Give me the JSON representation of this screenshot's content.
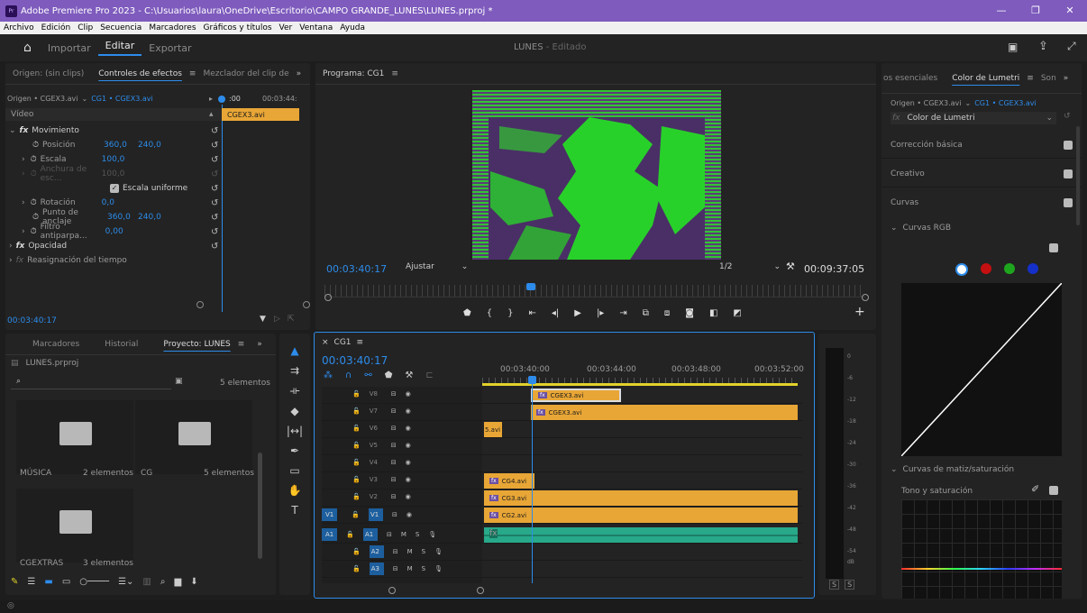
{
  "window": {
    "title": "Adobe Premiere Pro 2023 - C:\\Usuarios\\laura\\OneDrive\\Escritorio\\CAMPO GRANDE_LUNES\\LUNES.prproj *",
    "app_icon": "Pr"
  },
  "menu": [
    "Archivo",
    "Edición",
    "Clip",
    "Secuencia",
    "Marcadores",
    "Gráficos y títulos",
    "Ver",
    "Ventana",
    "Ayuda"
  ],
  "workspaces": {
    "import": "Importar",
    "edit": "Editar",
    "export": "Exportar",
    "project_title": "LUNES",
    "status": "- Editado"
  },
  "effect_controls": {
    "tabs": [
      "Origen: (sin clips)",
      "Controles de efectos",
      "Mezclador del clip de"
    ],
    "source": "Origen • CGEX3.avi",
    "clip": "CG1 • CGEX3.avi",
    "ruler_start": ":00",
    "ruler_end": "00:03:44:",
    "clip_label": "CGEX3.avi",
    "section": "Vídeo",
    "rows": [
      {
        "label": "Movimiento",
        "fx": true
      },
      {
        "label": "Posición",
        "v1": "360,0",
        "v2": "240,0"
      },
      {
        "label": "Escala",
        "v1": "100,0"
      },
      {
        "label": "Anchura de esc...",
        "v1": "100,0",
        "dim": true
      },
      {
        "label": "Escala uniforme",
        "checkbox": true
      },
      {
        "label": "Rotación",
        "v1": "0,0"
      },
      {
        "label": "Punto de anclaje",
        "v1": "360,0",
        "v2": "240,0"
      },
      {
        "label": "Filtro antiparpa...",
        "v1": "0,00"
      },
      {
        "label": "Opacidad",
        "fx": true
      },
      {
        "label": "Reasignación del tiempo",
        "fx": true
      }
    ],
    "timecode": "00:03:40:17"
  },
  "program": {
    "tab": "Programa: CG1",
    "timecode": "00:03:40:17",
    "fit": "Ajustar",
    "resolution": "1/2",
    "duration": "00:09:37:05"
  },
  "project": {
    "tabs": [
      "Marcadores",
      "Historial",
      "Proyecto: LUNES"
    ],
    "file": "LUNES.prproj",
    "count": "5 elementos",
    "bins": [
      {
        "name": "MÚSICA",
        "count": "2 elementos"
      },
      {
        "name": "CG",
        "count": "5 elementos"
      },
      {
        "name": "CGEXTRAS",
        "count": "3 elementos"
      }
    ]
  },
  "timeline": {
    "tab": "CG1",
    "timecode": "00:03:40:17",
    "ruler": [
      "00:03:40:00",
      "00:03:44:00",
      "00:03:48:00",
      "00:03:52:00"
    ],
    "video_tracks": [
      "V8",
      "V7",
      "V6",
      "V5",
      "V4",
      "V3",
      "V2",
      "V1"
    ],
    "audio_tracks": [
      "A1",
      "A2",
      "A3"
    ],
    "src_v": "V1",
    "src_a": "A1",
    "clips": {
      "v8": "CGEX3.avi",
      "v7": "CGEX3.avi",
      "v6": "5.avi",
      "v3": "CG4.avi",
      "v2": "CG3.avi",
      "v1": "CG2.avi"
    },
    "track_buttons": {
      "m": "M",
      "s": "S"
    }
  },
  "meter": {
    "scale": [
      "0",
      "-6",
      "-12",
      "-18",
      "-24",
      "-30",
      "-36",
      "-42",
      "-48",
      "-54",
      "dB"
    ],
    "solo": [
      "S",
      "S"
    ]
  },
  "lumetri": {
    "tabs": [
      "os esenciales",
      "Color de Lumetri",
      "Son"
    ],
    "source": "Origen • CGEX3.avi",
    "clip": "CG1 • CGEX3.avi",
    "effect": "Color de Lumetri",
    "sections": [
      "Corrección básica",
      "Creativo",
      "Curvas"
    ],
    "rgb": "Curvas RGB",
    "hue_sat": "Curvas de matiz/saturación",
    "hue_vs_sat": "Tono y saturación",
    "colors": {
      "white": "#ffffff",
      "red": "#c41010",
      "green": "#1ea51e",
      "blue": "#1530c8"
    }
  },
  "accent": "#2d8ceb",
  "clip_color": "#e8a636",
  "audio_color": "#27a98a"
}
